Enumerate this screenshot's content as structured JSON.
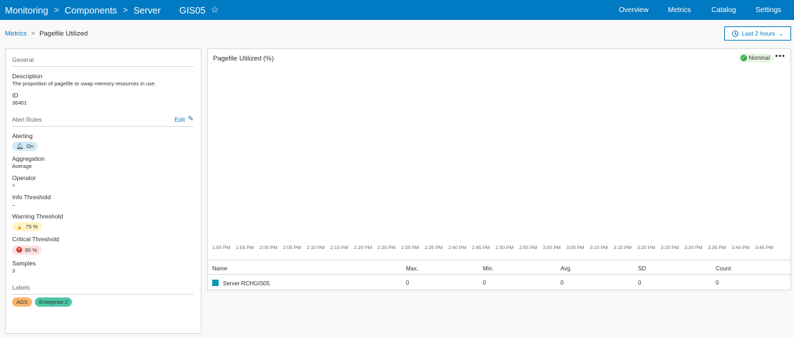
{
  "topbar": {
    "crumbs": [
      "Monitoring",
      "Components",
      "Server"
    ],
    "machine": "GIS05",
    "star_icon": "star-outline-icon",
    "nav": [
      "Overview",
      "Metrics",
      "Catalog",
      "Settings"
    ]
  },
  "subheader": {
    "crumb_link": "Metrics",
    "crumb_current": "Pagefile Utilized",
    "time_range": "Last 2 hours"
  },
  "general": {
    "heading": "General",
    "description_label": "Description",
    "description_value": "The proportion of pagefile or swap memory resources in use.",
    "id_label": "ID",
    "id_value": "36401"
  },
  "alert_rules": {
    "heading": "Alert Rules",
    "edit_label": "Edit",
    "alerting_label": "Alerting",
    "alerting_value": "On",
    "aggregation_label": "Aggregation",
    "aggregation_value": "Average",
    "operator_label": "Operator",
    "operator_value": ">",
    "info_label": "Info Threshold",
    "info_value": "–",
    "warning_label": "Warning Threshold",
    "warning_value": "75 %",
    "critical_label": "Critical Threshold",
    "critical_value": "90 %",
    "samples_label": "Samples",
    "samples_value": "3"
  },
  "labels": {
    "heading": "Labels",
    "items": [
      "AGS",
      "Enterprise 2"
    ]
  },
  "chart": {
    "title": "Pagefile Utilized (%)",
    "status": "Nominal",
    "more": "•••"
  },
  "chart_data": {
    "type": "line",
    "title": "Pagefile Utilized (%)",
    "x": [
      "1:50 PM",
      "1:55 PM",
      "2:00 PM",
      "2:05 PM",
      "2:10 PM",
      "2:15 PM",
      "2:20 PM",
      "2:25 PM",
      "2:30 PM",
      "2:35 PM",
      "2:40 PM",
      "2:45 PM",
      "2:50 PM",
      "2:55 PM",
      "3:00 PM",
      "3:05 PM",
      "3:10 PM",
      "3:15 PM",
      "3:20 PM",
      "3:25 PM",
      "3:30 PM",
      "3:35 PM",
      "3:40 PM",
      "3:45 PM"
    ],
    "series": [
      {
        "name": "Server RCHGIS05",
        "values": [],
        "color": "#0c97b5"
      }
    ],
    "grid": false
  },
  "table": {
    "headers": [
      "Name",
      "Max.",
      "Min.",
      "Avg.",
      "SD",
      "Count"
    ],
    "rows": [
      {
        "name": "Server RCHGIS05",
        "max": "0",
        "min": "0",
        "avg": "0",
        "sd": "0",
        "count": "0"
      }
    ]
  },
  "colors": {
    "brand": "#007ac2",
    "nominal": "#35ac46",
    "series": "#0c97b5"
  }
}
